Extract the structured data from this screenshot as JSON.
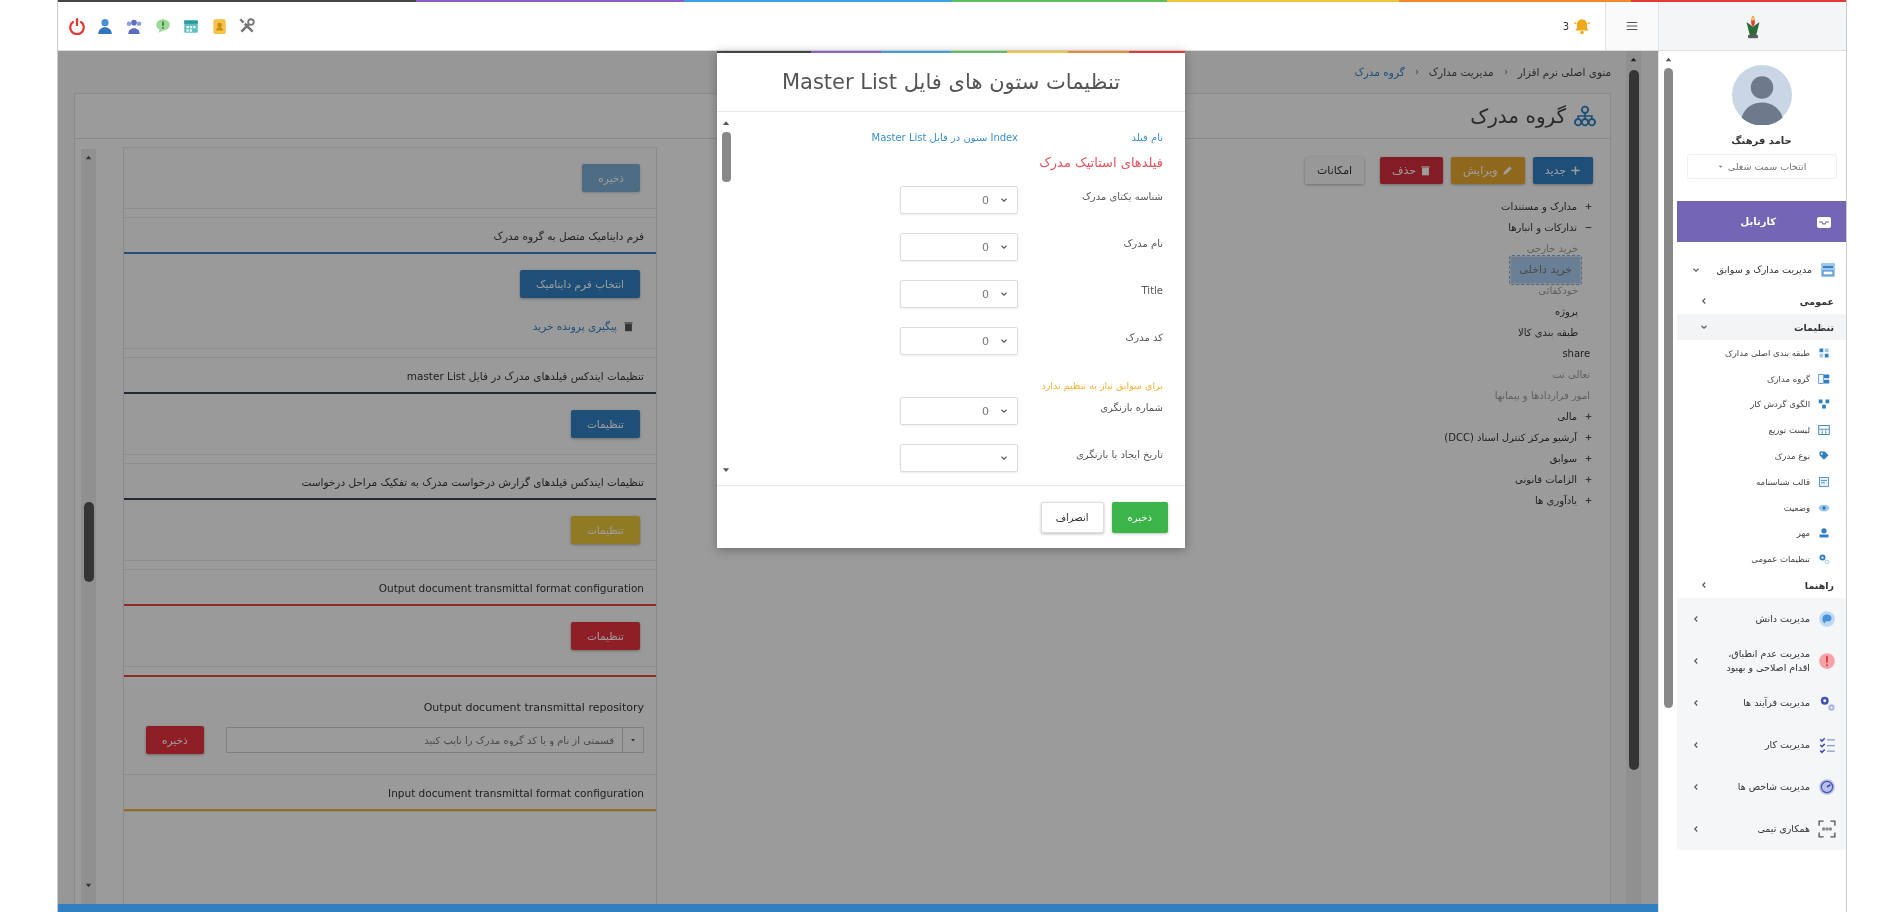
{
  "topbar": {
    "notification_count": "3"
  },
  "breadcrumb": [
    {
      "label": "منوی اصلی نرم افزار",
      "current": false
    },
    {
      "label": "مدیریت مدارک",
      "current": false
    },
    {
      "label": "گروه مدرک",
      "current": true
    }
  ],
  "page": {
    "title": "گروه مدرک"
  },
  "toolbar": [
    {
      "label": "جدید",
      "kind": "new"
    },
    {
      "label": "ویرایش",
      "kind": "edit"
    },
    {
      "label": "حذف",
      "kind": "delete"
    },
    {
      "label": "امکانات",
      "kind": "options"
    }
  ],
  "tree": [
    {
      "label": "مدارک و مستندات",
      "expanded": false,
      "selected": false,
      "disabled": false
    },
    {
      "label": "تدارکات و انبارها",
      "expanded": true,
      "selected": false,
      "disabled": false,
      "children": [
        {
          "label": "خرید خارجی",
          "selected": false,
          "disabled": true
        },
        {
          "label": "خرید داخلی",
          "selected": true,
          "disabled": false
        },
        {
          "label": "خودکفائی",
          "selected": false,
          "disabled": true
        },
        {
          "label": "پروژه",
          "selected": false,
          "disabled": false
        },
        {
          "label": "طبقه بندی کالا",
          "selected": false,
          "disabled": false
        }
      ]
    },
    {
      "label": "share",
      "selected": false,
      "disabled": false
    },
    {
      "label": "تعالی تت",
      "selected": false,
      "disabled": true
    },
    {
      "label": "امور قراردادها و پیمانها",
      "selected": false,
      "disabled": true
    },
    {
      "label": "مالی",
      "expanded": false,
      "selected": false,
      "disabled": false
    },
    {
      "label": "آرشیو مرکز کنترل اسناد (DCC)",
      "expanded": false,
      "selected": false,
      "disabled": false
    },
    {
      "label": "سوابق",
      "expanded": false,
      "selected": false,
      "disabled": false
    },
    {
      "label": "الزامات قانونی",
      "expanded": false,
      "selected": false,
      "disabled": false
    },
    {
      "label": "یادآوری ها",
      "expanded": false,
      "selected": false,
      "disabled": false
    }
  ],
  "sections": [
    {
      "kind": "save",
      "button": "ذخیره",
      "disabled": true
    },
    {
      "kind": "form",
      "title": "فرم داینامیک متصل به گروه مدرک",
      "color": "#244f7c",
      "button": "انتخاب فرم داینامیک",
      "link": "پیگیری پرونده خرید"
    },
    {
      "kind": "settings",
      "title": "تنظیمات ایندکس فیلدهای مدرک در فایل master List",
      "color": "#252b35",
      "button": "تنظیمات"
    },
    {
      "kind": "settings",
      "title": "تنظیمات ایندکس فیلدهای گزارش درخواست مدرک به تفکیک مراحل درخواست",
      "color": "#252b35",
      "button": "تنظیمات"
    },
    {
      "kind": "settings",
      "title": "Output document transmittal format configuration",
      "color": "#902a24",
      "button": "تنظیمات"
    },
    {
      "kind": "repository",
      "title": "Output document transmittal repository",
      "color": "#902a24",
      "placeholder": "قسمتی از نام و یا کد گروه مدرک را تایپ کنید",
      "button": "ذخیره"
    },
    {
      "kind": "header",
      "title": "Input document transmittal format configuration",
      "color": "#956d1e"
    }
  ],
  "dialog": {
    "title": "تنظیمات ستون های فایل Master List",
    "columns": [
      "نام فیلد",
      "Index ستون در فایل Master List"
    ],
    "rows": [
      {
        "kind": "heading",
        "text": "فیلدهای استاتیک مدرک"
      },
      {
        "kind": "field",
        "label": "شناسه یکتای مدرک",
        "value": "0"
      },
      {
        "kind": "field",
        "label": "نام مدرک",
        "value": "0"
      },
      {
        "kind": "field",
        "label": "Title",
        "value": "0"
      },
      {
        "kind": "field",
        "label": "کد مدرک",
        "value": "0"
      },
      {
        "kind": "note",
        "text": "برای سوابق نیاز به تنظیم ندارد"
      },
      {
        "kind": "field",
        "label": "شماره بازنگری",
        "value": "0"
      },
      {
        "kind": "field",
        "label": "تاریخ ایجاد یا بازنگری"
      }
    ],
    "buttons": [
      {
        "label": "ذخیره",
        "kind": "primary"
      },
      {
        "label": "انصراف",
        "kind": "secondary"
      }
    ]
  },
  "user": {
    "name": "حامد فرهنگ",
    "role_select": "انتخاب سمت شغلی"
  },
  "kartable": "کارتابل",
  "menu": [
    {
      "label": "مدیریت مدارک و سوابق",
      "expanded": true,
      "children": [
        {
          "label": "عمومی",
          "expanded": false
        },
        {
          "label": "تنظیمات",
          "expanded": true,
          "children": [
            {
              "label": "طبقه بندی اصلی مدارک"
            },
            {
              "label": "گروه مدارک"
            },
            {
              "label": "الگوی گردش کار"
            },
            {
              "label": "لیست توزیع"
            },
            {
              "label": "نوع مدرک"
            },
            {
              "label": "قالب شناسنامه"
            },
            {
              "label": "وضعیت"
            },
            {
              "label": "مهر"
            },
            {
              "label": "تنظیمات عمومی"
            }
          ]
        },
        {
          "label": "راهنما",
          "expanded": false
        }
      ]
    },
    {
      "label": "مدیریت دانش",
      "expanded": false
    },
    {
      "label": "مدیریت عدم انطباق، اقدام اصلاحی و بهبود",
      "expanded": false
    },
    {
      "label": "مدیریت فرآیند ها",
      "expanded": false
    },
    {
      "label": "مدیریت کار",
      "expanded": false
    },
    {
      "label": "مدیریت شاخص ها",
      "expanded": false
    },
    {
      "label": "همکاری تیمی",
      "expanded": false
    }
  ]
}
